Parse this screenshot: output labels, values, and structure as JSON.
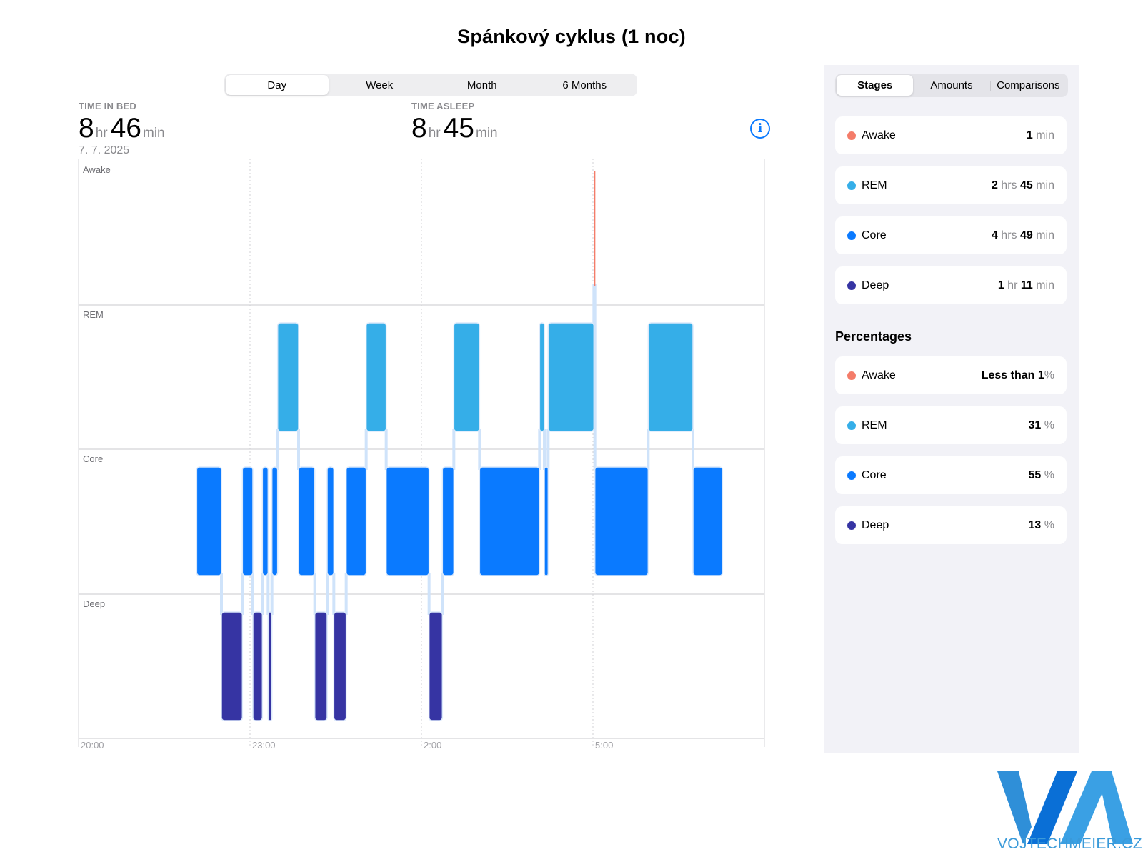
{
  "title": "Spánkový cyklus (1 noc)",
  "period_tabs": [
    {
      "label": "Day",
      "active": true
    },
    {
      "label": "Week",
      "active": false
    },
    {
      "label": "Month",
      "active": false
    },
    {
      "label": "6 Months",
      "active": false
    }
  ],
  "time_in_bed": {
    "label": "TIME IN BED",
    "hours": "8",
    "hours_unit": "hr",
    "minutes": "46",
    "minutes_unit": "min",
    "date": "7. 7. 2025"
  },
  "time_asleep": {
    "label": "TIME ASLEEP",
    "hours": "8",
    "hours_unit": "hr",
    "minutes": "45",
    "minutes_unit": "min"
  },
  "info_icon": "info-circle-icon",
  "view_tabs": [
    {
      "label": "Stages",
      "active": true
    },
    {
      "label": "Amounts",
      "active": false
    },
    {
      "label": "Comparisons",
      "active": false
    }
  ],
  "amounts": [
    {
      "stage": "Awake",
      "color": "#f47c69",
      "parts": [
        {
          "v": "1",
          "u": " min"
        }
      ]
    },
    {
      "stage": "REM",
      "color": "#35aee8",
      "parts": [
        {
          "v": "2",
          "u": " hrs "
        },
        {
          "v": "45",
          "u": " min"
        }
      ]
    },
    {
      "stage": "Core",
      "color": "#0a7aff",
      "parts": [
        {
          "v": "4",
          "u": " hrs "
        },
        {
          "v": "49",
          "u": " min"
        }
      ]
    },
    {
      "stage": "Deep",
      "color": "#3634a3",
      "parts": [
        {
          "v": "1",
          "u": " hr "
        },
        {
          "v": "11",
          "u": " min"
        }
      ]
    }
  ],
  "percentages_heading": "Percentages",
  "percentages": [
    {
      "stage": "Awake",
      "color": "#f47c69",
      "parts": [
        {
          "v": "Less than 1",
          "u": "%"
        }
      ]
    },
    {
      "stage": "REM",
      "color": "#35aee8",
      "parts": [
        {
          "v": "31",
          "u": " %"
        }
      ]
    },
    {
      "stage": "Core",
      "color": "#0a7aff",
      "parts": [
        {
          "v": "55",
          "u": " %"
        }
      ]
    },
    {
      "stage": "Deep",
      "color": "#3634a3",
      "parts": [
        {
          "v": "13",
          "u": " %"
        }
      ]
    }
  ],
  "logo_text": "VOJTECHMEIER.CZ",
  "brand_color": "#3a9ad9",
  "chart_data": {
    "type": "timeline",
    "stages": [
      "Awake",
      "REM",
      "Core",
      "Deep"
    ],
    "stage_colors": {
      "Awake": "#f47c69",
      "REM": "#35aee8",
      "Core": "#0a7aff",
      "Deep": "#3634a3"
    },
    "x_ticks": [
      "20:00",
      "23:00",
      "2:00",
      "5:00"
    ],
    "x_range": [
      "20:00",
      "08:00"
    ],
    "segments": [
      {
        "stage": "Core",
        "start": "22:04",
        "end": "22:30"
      },
      {
        "stage": "Deep",
        "start": "22:30",
        "end": "22:52"
      },
      {
        "stage": "Core",
        "start": "22:52",
        "end": "23:03"
      },
      {
        "stage": "Deep",
        "start": "23:03",
        "end": "23:13"
      },
      {
        "stage": "Core",
        "start": "23:13",
        "end": "23:19"
      },
      {
        "stage": "Deep",
        "start": "23:19",
        "end": "23:23"
      },
      {
        "stage": "Core",
        "start": "23:23",
        "end": "23:29"
      },
      {
        "stage": "REM",
        "start": "23:29",
        "end": "23:51"
      },
      {
        "stage": "Core",
        "start": "23:51",
        "end": "24:08"
      },
      {
        "stage": "Deep",
        "start": "24:08",
        "end": "24:21"
      },
      {
        "stage": "Core",
        "start": "24:21",
        "end": "24:28"
      },
      {
        "stage": "Deep",
        "start": "24:28",
        "end": "24:41"
      },
      {
        "stage": "Core",
        "start": "24:41",
        "end": "25:02"
      },
      {
        "stage": "REM",
        "start": "25:02",
        "end": "25:23"
      },
      {
        "stage": "Core",
        "start": "25:23",
        "end": "26:08"
      },
      {
        "stage": "Deep",
        "start": "26:08",
        "end": "26:22"
      },
      {
        "stage": "Core",
        "start": "26:22",
        "end": "26:34"
      },
      {
        "stage": "REM",
        "start": "26:34",
        "end": "27:01"
      },
      {
        "stage": "Core",
        "start": "27:01",
        "end": "28:04"
      },
      {
        "stage": "REM",
        "start": "28:04",
        "end": "28:09"
      },
      {
        "stage": "Core",
        "start": "28:09",
        "end": "28:13"
      },
      {
        "stage": "REM",
        "start": "28:13",
        "end": "29:01"
      },
      {
        "stage": "Awake",
        "start": "29:01",
        "end": "29:02"
      },
      {
        "stage": "Core",
        "start": "29:02",
        "end": "29:58"
      },
      {
        "stage": "REM",
        "start": "29:58",
        "end": "30:45"
      },
      {
        "stage": "Core",
        "start": "30:45",
        "end": "31:16"
      }
    ]
  }
}
